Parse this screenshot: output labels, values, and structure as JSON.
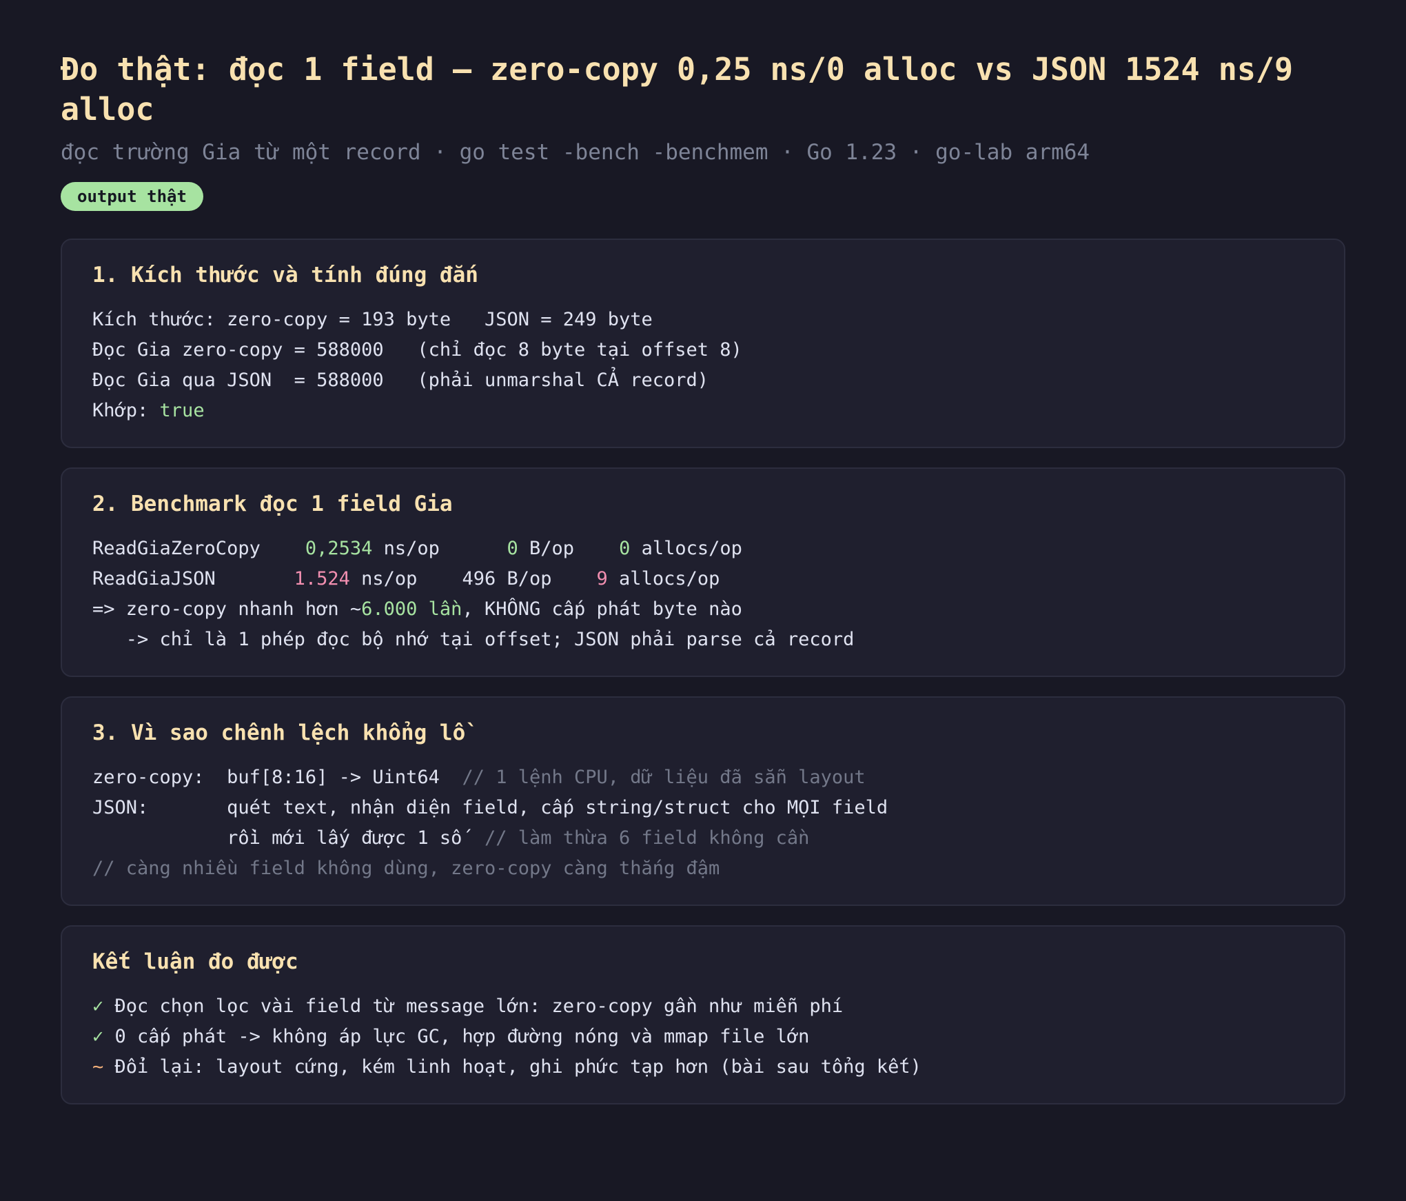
{
  "header": {
    "title": "Đo thật: đọc 1 field — zero-copy 0,25 ns/0 alloc vs JSON 1524 ns/9 alloc",
    "subtitle": "đọc trường Gia từ một record · go test -bench -benchmem · Go 1.23 · go-lab arm64",
    "badge": "output thật"
  },
  "sections": {
    "size": {
      "title": "1. Kích thước và tính đúng đắn",
      "line1": "Kích thước: zero-copy = 193 byte   JSON = 249 byte",
      "line2": "Đọc Gia zero-copy = 588000   (chỉ đọc 8 byte tại offset 8)",
      "line3": "Đọc Gia qua JSON  = 588000   (phải unmarshal CẢ record)",
      "line4_label": "Khớp: ",
      "line4_value": "true"
    },
    "bench": {
      "title": "2. Benchmark đọc 1 field Gia",
      "row1_name": "ReadGiaZeroCopy    ",
      "row1_ns": "0,2534",
      "row1_ns_unit": " ns/op      ",
      "row1_b": "0",
      "row1_b_unit": " B/op    ",
      "row1_allocs": "0",
      "row1_allocs_unit": " allocs/op",
      "row2_name": "ReadGiaJSON       ",
      "row2_ns": "1.524",
      "row2_ns_unit": " ns/op    ",
      "row2_b": "496 B/op    ",
      "row2_allocs": "9",
      "row2_allocs_unit": " allocs/op",
      "line3_pre": "=> zero-copy nhanh hơn ~",
      "line3_hl": "6.000 lần",
      "line3_post": ", KHÔNG cấp phát byte nào",
      "line4": "   -> chỉ là 1 phép đọc bộ nhớ tại offset; JSON phải parse cả record"
    },
    "why": {
      "title": "3. Vì sao chênh lệch khổng lồ",
      "line1_code": "zero-copy:  buf[8:16] -> Uint64  ",
      "line1_comment": "// 1 lệnh CPU, dữ liệu đã sẵn layout",
      "line2": "JSON:       quét text, nhận diện field, cấp string/struct cho MỌI field",
      "line3_code": "            rồi mới lấy được 1 số  ",
      "line3_comment": "// làm thừa 6 field không cần",
      "line4_comment": "// càng nhiều field không dùng, zero-copy càng thắng đậm"
    },
    "conclusion": {
      "title": "Kết luận đo được",
      "items": [
        {
          "mark": "✓",
          "text": " Đọc chọn lọc vài field từ message lớn: zero-copy gần như miễn phí"
        },
        {
          "mark": "✓",
          "text": " 0 cấp phát -> không áp lực GC, hợp đường nóng và mmap file lớn"
        },
        {
          "mark": "~",
          "text": " Đổi lại: layout cứng, kém linh hoạt, ghi phức tạp hơn (bài sau tổng kết)"
        }
      ]
    }
  },
  "colors": {
    "background": "#181824",
    "card": "#1f1f2e",
    "heading": "#f8e1b0",
    "good": "#a7e3a1",
    "bad": "#f28fb0",
    "tradeoff": "#f3b07a",
    "muted": "#737889"
  }
}
